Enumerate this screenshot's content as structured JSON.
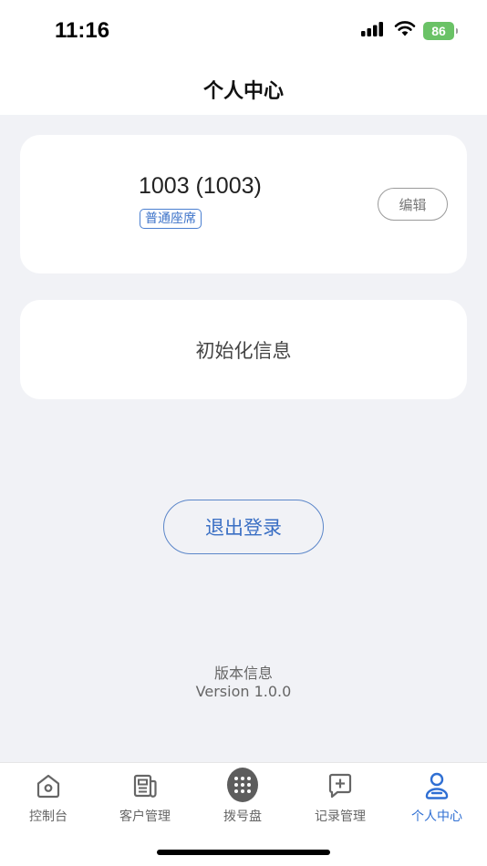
{
  "status_bar": {
    "time": "11:16",
    "battery": "86"
  },
  "nav": {
    "title": "个人中心"
  },
  "profile": {
    "name": "1003 (1003)",
    "role_tag": "普通座席",
    "edit_label": "编辑"
  },
  "init_info": {
    "label": "初始化信息"
  },
  "logout": {
    "label": "退出登录"
  },
  "version": {
    "title": "版本信息",
    "value": "Version 1.0.0"
  },
  "tabs": [
    {
      "label": "控制台",
      "icon": "home-icon"
    },
    {
      "label": "客户管理",
      "icon": "customer-icon"
    },
    {
      "label": "拨号盘",
      "icon": "dialpad-icon"
    },
    {
      "label": "记录管理",
      "icon": "records-icon"
    },
    {
      "label": "个人中心",
      "icon": "person-icon",
      "active": true
    }
  ],
  "colors": {
    "accent": "#2f6fd3",
    "background": "#f1f2f6",
    "battery": "#6ac266"
  }
}
